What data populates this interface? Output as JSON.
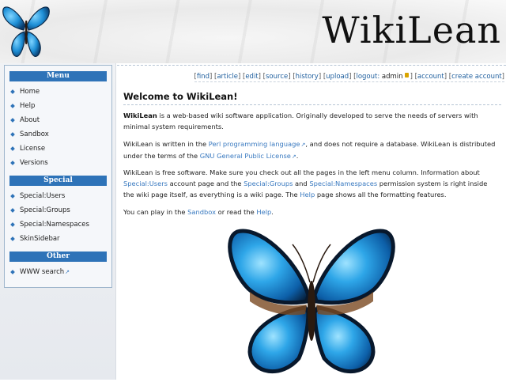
{
  "header": {
    "site_title": "WikiLean",
    "logo_icon": "butterfly-icon"
  },
  "sidebar": {
    "sections": [
      {
        "title": "Menu",
        "items": [
          "Home",
          "Help",
          "About",
          "Sandbox",
          "License",
          "Versions"
        ]
      },
      {
        "title": "Special",
        "items": [
          "Special:Users",
          "Special:Groups",
          "Special:Namespaces",
          "SkinSidebar"
        ]
      },
      {
        "title": "Other",
        "items": [
          "WWW search"
        ]
      }
    ]
  },
  "toolbar": {
    "find": "find",
    "article": "article",
    "edit": "edit",
    "source": "source",
    "history": "history",
    "upload": "upload",
    "logout": "logout:",
    "user": "admin",
    "account": "account",
    "create_account": "create account"
  },
  "article": {
    "title": "Welcome to WikiLean!",
    "p1_bold": "WikiLean",
    "p1_rest": " is a web-based wiki software application. Originally developed to serve the needs of servers with minimal system requirements.",
    "p2_a": "WikiLean is written in the ",
    "p2_link1": "Perl programming language",
    "p2_b": ", and does not require a database. WikiLean is distributed under the terms of the ",
    "p2_link2": "GNU General Public License",
    "p2_c": ".",
    "p3_a": "WikiLean is free software. Make sure you check out all the pages in the left menu column. Information about ",
    "p3_link1": "Special:Users",
    "p3_b": " account page and the ",
    "p3_link2": "Special:Groups",
    "p3_c": " and ",
    "p3_link3": "Special:Namespaces",
    "p3_d": " permission system is right inside the wiki page itself, as everything is a wiki page. The ",
    "p3_link4": "Help",
    "p3_e": " page shows all the formatting features.",
    "p4_a": "You can play in the ",
    "p4_link1": "Sandbox",
    "p4_b": " or read the ",
    "p4_link2": "Help",
    "p4_c": "."
  },
  "colors": {
    "accent": "#2e73b8",
    "link": "#3a7ac0",
    "butterfly": "#1e8fd6"
  }
}
